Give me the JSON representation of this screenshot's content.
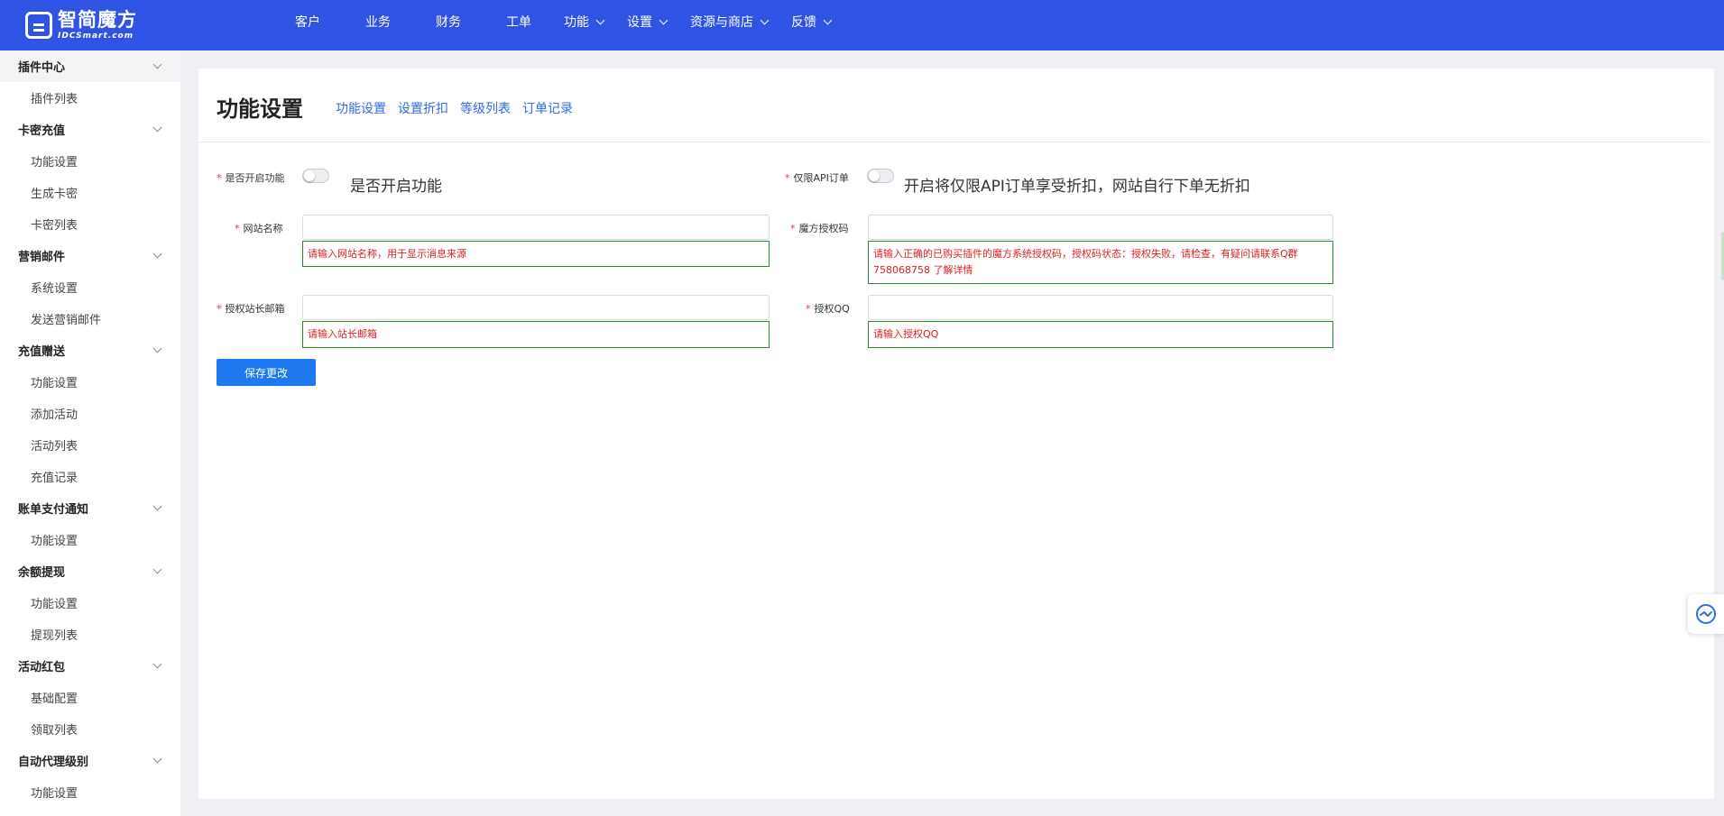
{
  "header": {
    "logo_cn": "智简魔方",
    "logo_en": "IDCSmart.com",
    "nav": [
      {
        "label": "客户",
        "dropdown": false
      },
      {
        "label": "业务",
        "dropdown": false
      },
      {
        "label": "财务",
        "dropdown": false
      },
      {
        "label": "工单",
        "dropdown": false
      },
      {
        "label": "功能",
        "dropdown": true
      },
      {
        "label": "设置",
        "dropdown": true
      },
      {
        "label": "资源与商店",
        "dropdown": true
      },
      {
        "label": "反馈",
        "dropdown": true
      }
    ]
  },
  "sidebar": {
    "groups": [
      {
        "title": "插件中心",
        "items": [
          "插件列表"
        ]
      },
      {
        "title": "卡密充值",
        "items": [
          "功能设置",
          "生成卡密",
          "卡密列表"
        ]
      },
      {
        "title": "营销邮件",
        "items": [
          "系统设置",
          "发送营销邮件"
        ]
      },
      {
        "title": "充值赠送",
        "items": [
          "功能设置",
          "添加活动",
          "活动列表",
          "充值记录"
        ]
      },
      {
        "title": "账单支付通知",
        "items": [
          "功能设置"
        ]
      },
      {
        "title": "余额提现",
        "items": [
          "功能设置",
          "提现列表"
        ]
      },
      {
        "title": "活动红包",
        "items": [
          "基础配置",
          "领取列表"
        ]
      },
      {
        "title": "自动代理级别",
        "items": [
          "功能设置"
        ]
      }
    ]
  },
  "main": {
    "title": "功能设置",
    "tabs": [
      "功能设置",
      "设置折扣",
      "等级列表",
      "订单记录"
    ],
    "form": {
      "enable": {
        "label": "是否开启功能",
        "desc": "是否开启功能",
        "on": false
      },
      "api_only": {
        "label": "仅限API订单",
        "desc": "开启将仅限API订单享受折扣，网站自行下单无折扣",
        "on": false
      },
      "site_name": {
        "label": "网站名称",
        "value": "",
        "error": "请输入网站名称，用于显示消息来源"
      },
      "auth_code": {
        "label": "魔方授权码",
        "value": "",
        "error": "请输入正确的已购买插件的魔方系统授权码，授权码状态：授权失败，请检查，有疑问请联系Q群758068758 了解详情"
      },
      "email": {
        "label": "授权站长邮箱",
        "value": "",
        "error": "请输入站长邮箱"
      },
      "qq": {
        "label": "授权QQ",
        "value": "",
        "error": "请输入授权QQ"
      }
    },
    "save_label": "保存更改"
  },
  "colors": {
    "topbar": "#2f53e3",
    "link": "#2f6ce8",
    "button": "#1e78f0",
    "error_text": "#e02020",
    "error_border": "#2c8a2c"
  }
}
